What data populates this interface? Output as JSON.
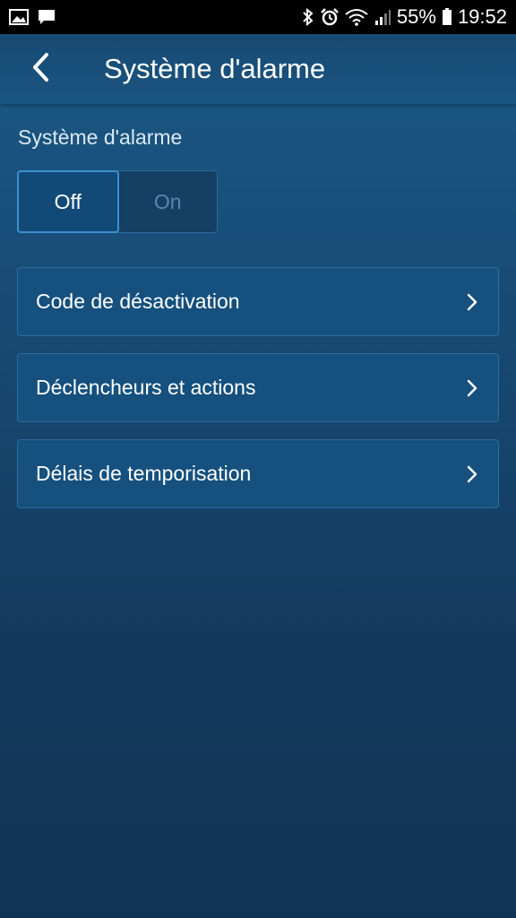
{
  "status_bar": {
    "battery": "55%",
    "time": "19:52"
  },
  "app_bar": {
    "title": "Système d'alarme"
  },
  "alarm_section": {
    "label": "Système d'alarme",
    "toggle": {
      "off_label": "Off",
      "on_label": "On",
      "selected": "Off"
    }
  },
  "menu": {
    "items": [
      {
        "label": "Code de désactivation"
      },
      {
        "label": "Déclencheurs et actions"
      },
      {
        "label": "Délais de temporisation"
      }
    ]
  },
  "colors": {
    "accent": "#3a8fd0",
    "background": "#174a74",
    "status_bar": "#000000"
  },
  "icons": {
    "status_left": [
      "image-icon",
      "message-icon"
    ],
    "status_right": [
      "bluetooth-icon",
      "alarm-clock-icon",
      "wifi-icon",
      "signal-icon",
      "battery-icon"
    ],
    "back": "back-arrow-icon",
    "menu_chevron": "chevron-right-icon"
  }
}
